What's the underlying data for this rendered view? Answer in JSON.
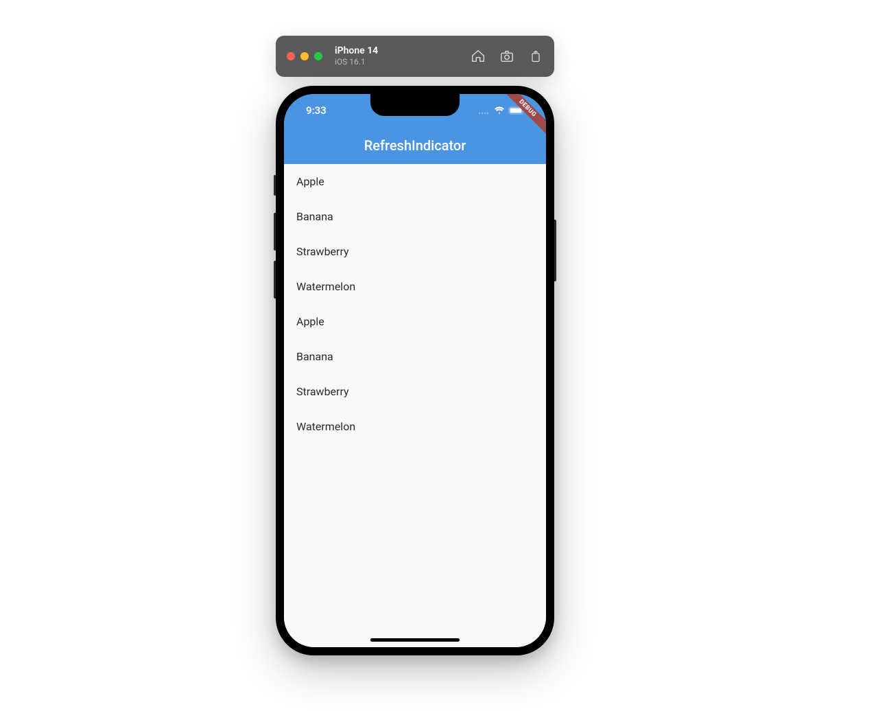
{
  "simulator": {
    "device_name": "iPhone 14",
    "os_version": "iOS 16.1"
  },
  "status_bar": {
    "time": "9:33"
  },
  "app_bar": {
    "title": "RefreshIndicator"
  },
  "debug_banner": {
    "label": "DEBUG"
  },
  "list": {
    "items": [
      {
        "label": "Apple"
      },
      {
        "label": "Banana"
      },
      {
        "label": "Strawberry"
      },
      {
        "label": "Watermelon"
      },
      {
        "label": "Apple"
      },
      {
        "label": "Banana"
      },
      {
        "label": "Strawberry"
      },
      {
        "label": "Watermelon"
      }
    ]
  },
  "colors": {
    "primary": "#4a94e1",
    "toolbar_bg": "#5a5a5a",
    "debug_banner": "#9e4a4a"
  }
}
